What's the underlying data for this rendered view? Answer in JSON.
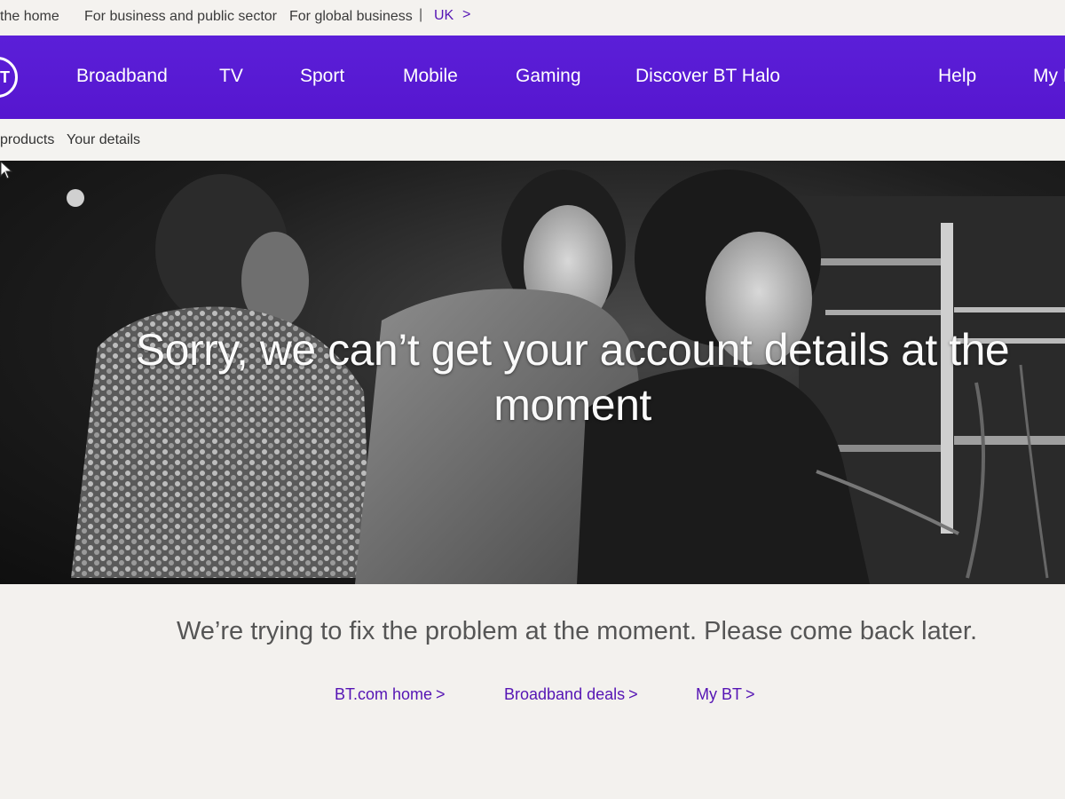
{
  "utility_bar": {
    "home": "the home",
    "business": "For business and public sector",
    "global": "For global business",
    "separator": "|",
    "region": "UK",
    "region_chevron": ">"
  },
  "nav": {
    "logo_text": "T",
    "items": [
      "Broadband",
      "TV",
      "Sport",
      "Mobile",
      "Gaming",
      "Discover BT Halo"
    ],
    "help": "Help",
    "my_bt": "My B"
  },
  "breadcrumb": {
    "products": "products",
    "current": "Your details"
  },
  "hero": {
    "title": "Sorry, we can’t get your account details at the moment"
  },
  "message": "We’re trying to fix the problem at the moment. Please come back later.",
  "links": [
    {
      "label": "BT.com home",
      "chevron": ">"
    },
    {
      "label": "Broadband deals",
      "chevron": ">"
    },
    {
      "label": "My BT",
      "chevron": ">"
    }
  ],
  "colors": {
    "brand_purple": "#5514b4",
    "nav_background": "#5b1fd8"
  }
}
